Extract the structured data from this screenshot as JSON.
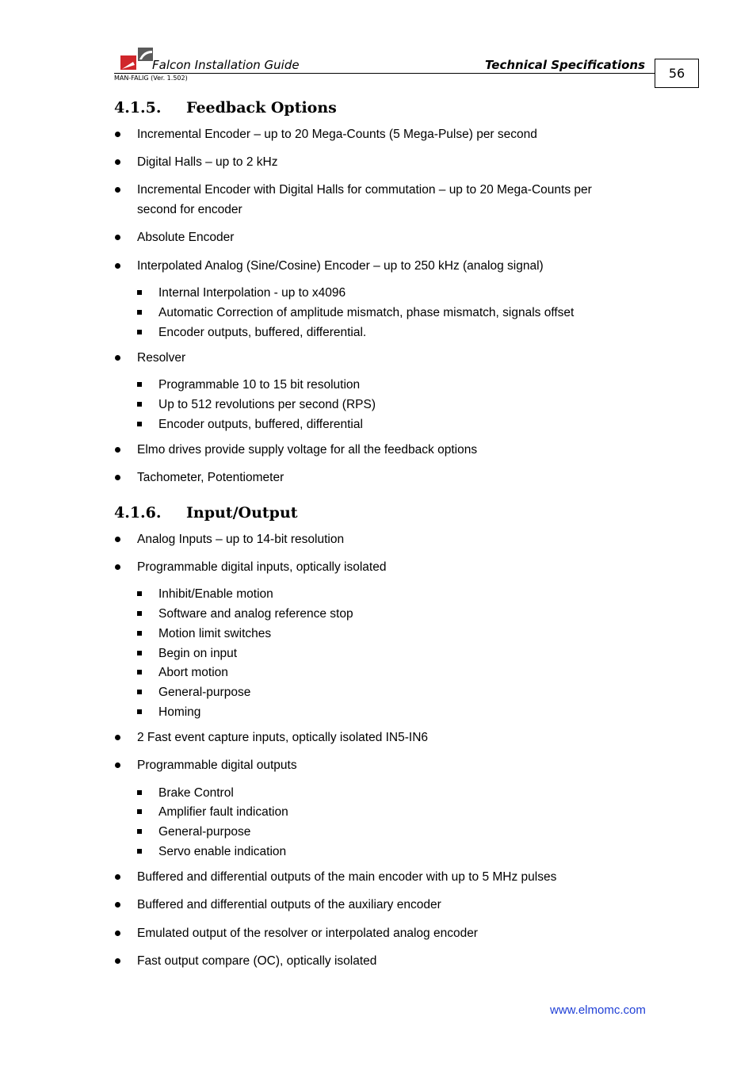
{
  "header": {
    "guide_title": "Falcon Installation Guide",
    "doc_version": "MAN-FALIG (Ver. 1.502)",
    "section_title": "Technical Specifications",
    "page_number": "56",
    "logo_colors": {
      "red": "#d0262b",
      "gray": "#5a5a5a"
    }
  },
  "sections": [
    {
      "number": "4.1.5.",
      "title": "Feedback Options",
      "items": [
        {
          "text": "Incremental Encoder – up to 20 Mega-Counts (5 Mega-Pulse) per second"
        },
        {
          "text": "Digital Halls – up to 2 kHz"
        },
        {
          "text": "Incremental Encoder with Digital Halls for commutation – up to 20 Mega-Counts per second for encoder"
        },
        {
          "text": "Absolute Encoder"
        },
        {
          "text": "Interpolated Analog (Sine/Cosine) Encoder – up to 250 kHz (analog signal)",
          "subitems": [
            "Internal Interpolation - up to x4096",
            "Automatic Correction of amplitude mismatch, phase mismatch, signals offset",
            "Encoder outputs, buffered, differential."
          ]
        },
        {
          "text": "Resolver",
          "subitems": [
            "Programmable 10 to 15 bit resolution",
            "Up to 512 revolutions per second (RPS)",
            "Encoder outputs, buffered, differential"
          ]
        },
        {
          "text": "Elmo drives provide supply voltage for all the feedback options"
        },
        {
          "text": "Tachometer, Potentiometer"
        }
      ]
    },
    {
      "number": "4.1.6.",
      "title": "Input/Output",
      "items": [
        {
          "text": "Analog Inputs – up to 14-bit resolution"
        },
        {
          "text": "Programmable digital inputs, optically isolated",
          "subitems": [
            "Inhibit/Enable motion",
            "Software and analog reference stop",
            "Motion limit switches",
            "Begin on input",
            "Abort motion",
            "General-purpose",
            "Homing"
          ]
        },
        {
          "text": "2 Fast event capture inputs, optically isolated IN5-IN6"
        },
        {
          "text": "Programmable digital outputs",
          "subitems": [
            "Brake Control",
            "Amplifier fault indication",
            "General-purpose",
            "Servo enable indication"
          ]
        },
        {
          "text": "Buffered and differential outputs of the main encoder with up to 5 MHz pulses"
        },
        {
          "text": "Buffered and differential outputs of the auxiliary encoder"
        },
        {
          "text": "Emulated output of the resolver or interpolated analog encoder"
        },
        {
          "text": "Fast output compare (OC), optically isolated"
        }
      ]
    }
  ],
  "footer": {
    "website": "www.elmomc.com",
    "link_color": "#1f3fd6"
  }
}
